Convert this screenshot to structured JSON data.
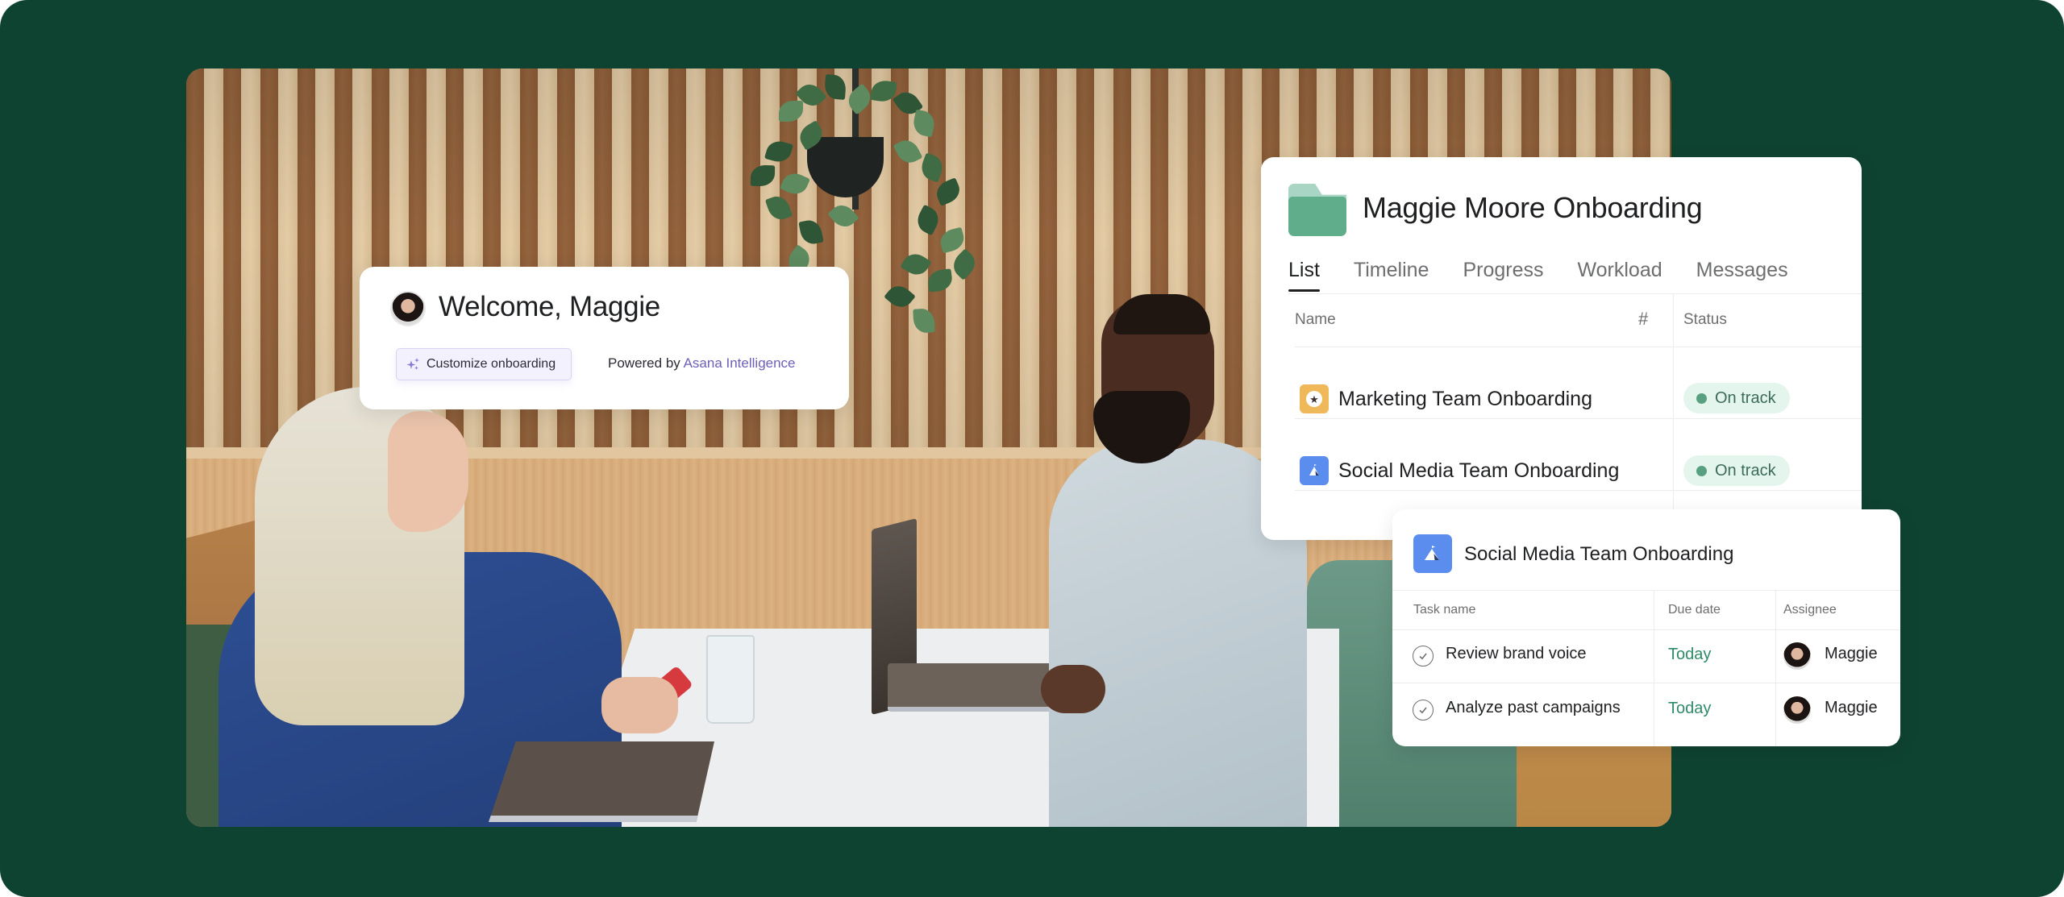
{
  "colors": {
    "background": "#0f4331",
    "accent_ai": "#6e5fb8",
    "status_green": "#58a07f",
    "due_today": "#2f8a68",
    "folder_green": "#5fad8b",
    "icon_gold": "#efb858",
    "icon_blue": "#5b8def"
  },
  "welcome_card": {
    "avatar_icon": "user-avatar",
    "title": "Welcome, Maggie",
    "customize_button": {
      "icon": "sparkle-icon",
      "label": "Customize onboarding"
    },
    "powered_by_prefix": "Powered by",
    "powered_by_link": "Asana Intelligence"
  },
  "project_card": {
    "icon": "folder-icon",
    "title": "Maggie Moore Onboarding",
    "tabs": [
      {
        "label": "List",
        "active": true
      },
      {
        "label": "Timeline",
        "active": false
      },
      {
        "label": "Progress",
        "active": false
      },
      {
        "label": "Workload",
        "active": false
      },
      {
        "label": "Messages",
        "active": false
      }
    ],
    "columns": {
      "name": "Name",
      "hash_icon": "#",
      "status": "Status"
    },
    "rows": [
      {
        "icon": "star-icon",
        "name": "Marketing Team Onboarding",
        "status": "On track"
      },
      {
        "icon": "mountain-flag-icon",
        "name": "Social Media Team Onboarding",
        "status": "On track"
      }
    ]
  },
  "tasks_card": {
    "icon": "mountain-flag-icon",
    "title": "Social Media Team Onboarding",
    "columns": {
      "task_name": "Task name",
      "due_date": "Due date",
      "assignee": "Assignee"
    },
    "rows": [
      {
        "task": "Review brand voice",
        "due": "Today",
        "assignee": "Maggie"
      },
      {
        "task": "Analyze past campaigns",
        "due": "Today",
        "assignee": "Maggie"
      }
    ]
  }
}
